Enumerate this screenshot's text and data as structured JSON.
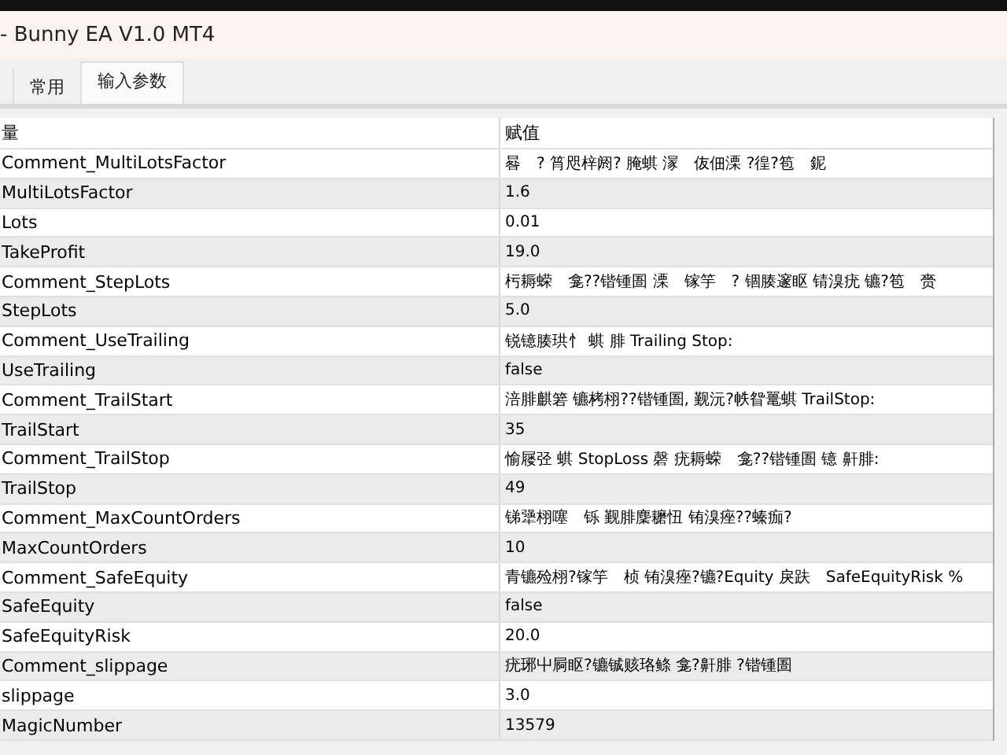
{
  "window": {
    "title": "- Bunny EA V1.0 MT4"
  },
  "tabs": [
    {
      "label": "常用",
      "selected": false
    },
    {
      "label": "输入参数",
      "selected": true
    }
  ],
  "table": {
    "columns": [
      "量",
      "赋值"
    ],
    "rows": [
      {
        "name": "Comment_MultiLotsFactor",
        "value": "晷　? 筲咫梓阏? 腌蜞 溕　伖佃溧 ?徨?笣　鈮"
      },
      {
        "name": "MultiLotsFactor",
        "value": "1.6"
      },
      {
        "name": "Lots",
        "value": "0.01"
      },
      {
        "name": "TakeProfit",
        "value": "19.0"
      },
      {
        "name": "Comment_StepLots",
        "value": "杇耨蝾　龛??锴锺圄 溧　镓竽　? 锢腠邃眍 锖溴疣 镳?笣　赍"
      },
      {
        "name": "StepLots",
        "value": "5.0"
      },
      {
        "name": "Comment_UseTrailing",
        "value": "锐镱腠珙忄 蜞 腓 Trailing Stop:"
      },
      {
        "name": "UseTrailing",
        "value": "false"
      },
      {
        "name": "Comment_TrailStart",
        "value": "涪腓麒箬 镳栲栩??锴锺圄, 觐沅?帙眢鼍蜞 TrailStop:"
      },
      {
        "name": "TrailStart",
        "value": "35"
      },
      {
        "name": "Comment_TrailStop",
        "value": "愉屦弪 蜞 StopLoss 磬 疣耨蝾　龛??锴锺圄 镱 鼾腓:"
      },
      {
        "name": "TrailStop",
        "value": "49"
      },
      {
        "name": "Comment_MaxCountOrders",
        "value": "锑犟栩噻　铄 觐腓麇耱忸 铕溴痤??螓痂?"
      },
      {
        "name": "MaxCountOrders",
        "value": "10"
      },
      {
        "name": "Comment_SafeEquity",
        "value": "青镳殓栩?镓竽　桢 铕溴痤?镳?Equity 戾趺　SafeEquityRisk %"
      },
      {
        "name": "SafeEquity",
        "value": "false"
      },
      {
        "name": "SafeEquityRisk",
        "value": "20.0"
      },
      {
        "name": "Comment_slippage",
        "value": "疣琊屮屙眍?镳铖赅珞鲦 龛?鼾腓 ?锴锺圄"
      },
      {
        "name": "slippage",
        "value": "3.0"
      },
      {
        "name": "MagicNumber",
        "value": "13579"
      }
    ]
  }
}
